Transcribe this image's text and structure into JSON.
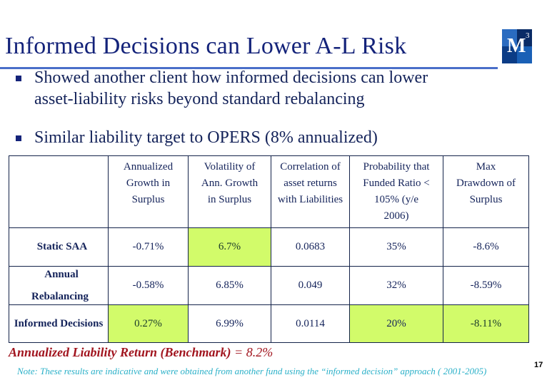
{
  "slide": {
    "title": "Informed Decisions can Lower A-L Risk",
    "logo": {
      "letter": "M",
      "superscript": "3"
    },
    "bullets": [
      {
        "line1": "Showed another client how informed decisions can lower",
        "line2": "asset-liability risks beyond standard rebalancing"
      },
      {
        "line1": "Similar liability target to OPERS (8% annualized)"
      }
    ],
    "page_number": "17"
  },
  "table": {
    "headers": [
      "",
      [
        "Annualized",
        "Growth in",
        "Surplus"
      ],
      [
        "Volatility of",
        "Ann. Growth",
        "in Surplus"
      ],
      [
        "Correlation of",
        "asset returns",
        "with Liabilities"
      ],
      [
        "Probability that",
        "Funded Ratio <",
        "105%  (y/e",
        "2006)"
      ],
      [
        "Max",
        "Drawdown of",
        "Surplus"
      ]
    ],
    "rows": [
      {
        "label": [
          "Static SAA"
        ],
        "values": [
          "-0.71%",
          "6.7%",
          "0.0683",
          "35%",
          "-8.6%"
        ]
      },
      {
        "label": [
          "Annual",
          "Rebalancing"
        ],
        "values": [
          "-0.58%",
          "6.85%",
          "0.049",
          "32%",
          "-8.59%"
        ]
      },
      {
        "label": [
          "Informed Decisions"
        ],
        "values": [
          "0.27%",
          "6.99%",
          "0.0114",
          "20%",
          "-8.11%"
        ]
      }
    ],
    "highlight_color": "#d2fb6a",
    "negative_color": "#a1141e"
  },
  "footer": {
    "benchmark_label": "Annualized Liability Return (Benchmark)",
    "benchmark_eq": " = 8.2%",
    "note": "Note: These results are indicative and were obtained from another fund using the “informed decision” approach ( 2001-2005)"
  }
}
